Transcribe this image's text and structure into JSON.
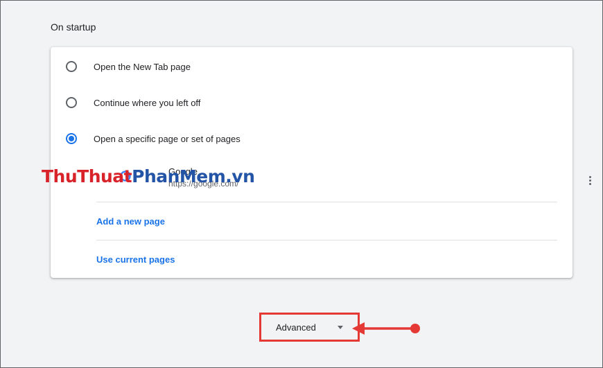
{
  "section": {
    "title": "On startup"
  },
  "startup_options": [
    {
      "label": "Open the New Tab page",
      "selected": false
    },
    {
      "label": "Continue where you left off",
      "selected": false
    },
    {
      "label": "Open a specific page or set of pages",
      "selected": true
    }
  ],
  "pages": [
    {
      "name": "Google",
      "url": "https://google.com/"
    }
  ],
  "links": {
    "add_page": "Add a new page",
    "use_current": "Use current pages"
  },
  "advanced": {
    "label": "Advanced"
  },
  "watermark": {
    "part1": "ThuThuat",
    "part2": "PhanMem",
    "part3": ".vn"
  },
  "colors": {
    "accent": "#1a73e8",
    "highlight": "#e53935"
  }
}
